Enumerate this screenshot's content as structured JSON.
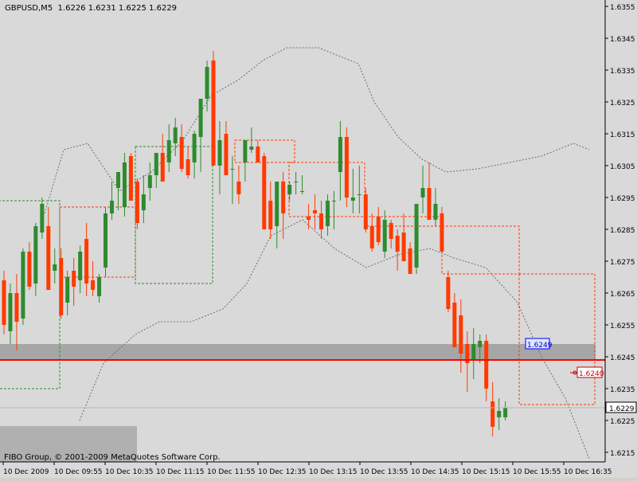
{
  "header": {
    "symbol": "GBPUSD,M5",
    "ohlc": "1.6226 1.6231 1.6225 1.6229"
  },
  "footer": {
    "copyright": "FIBO Group, © 2001-2009 MetaQuotes Software Corp."
  },
  "colors": {
    "background": "#d9d9d9",
    "bull": "#2e8b2e",
    "bear": "#ff3a00",
    "support_line": "#ff0000",
    "band": "#888888",
    "zone": "#a6a6a6"
  },
  "chart_data": {
    "type": "candlestick",
    "title": "GBPUSD,M5",
    "y_range": [
      1.6212,
      1.6357
    ],
    "y_ticks": [
      "1.6355",
      "1.6345",
      "1.6335",
      "1.6325",
      "1.6315",
      "1.6305",
      "1.6295",
      "1.6285",
      "1.6275",
      "1.6265",
      "1.6255",
      "1.6245",
      "1.6235",
      "1.6225",
      "1.6215"
    ],
    "x_ticks": [
      "10 Dec 2009",
      "10 Dec 09:55",
      "10 Dec 10:35",
      "10 Dec 11:15",
      "10 Dec 11:55",
      "10 Dec 12:35",
      "10 Dec 13:15",
      "10 Dec 13:55",
      "10 Dec 14:35",
      "10 Dec 15:15",
      "10 Dec 15:55",
      "10 Dec 16:35"
    ],
    "current_price": "1.6229",
    "price_labels": [
      {
        "text": "1.6249",
        "value": 1.6249,
        "style": "blue"
      },
      {
        "text": "1.6240",
        "value": 1.624,
        "style": "red"
      }
    ],
    "support_level": 1.6244,
    "zone": {
      "from": 1.6244,
      "to": 1.6249
    },
    "candles": [
      [
        1.6269,
        1.6272,
        1.6252,
        1.6255
      ],
      [
        1.6253,
        1.6268,
        1.6249,
        1.6265
      ],
      [
        1.6265,
        1.6271,
        1.6247,
        1.6256
      ],
      [
        1.6257,
        1.6279,
        1.6255,
        1.6278
      ],
      [
        1.6278,
        1.6281,
        1.6266,
        1.6267
      ],
      [
        1.6268,
        1.6287,
        1.6264,
        1.6286
      ],
      [
        1.6284,
        1.6295,
        1.6282,
        1.6293
      ],
      [
        1.6286,
        1.6292,
        1.6266,
        1.6266
      ],
      [
        1.6272,
        1.6279,
        1.6268,
        1.6274
      ],
      [
        1.6276,
        1.6279,
        1.6257,
        1.6258
      ],
      [
        1.6262,
        1.6272,
        1.6258,
        1.627
      ],
      [
        1.6272,
        1.6276,
        1.6261,
        1.6267
      ],
      [
        1.6269,
        1.628,
        1.6265,
        1.6278
      ],
      [
        1.6282,
        1.6287,
        1.6264,
        1.6268
      ],
      [
        1.6269,
        1.6275,
        1.6264,
        1.6266
      ],
      [
        1.6264,
        1.6271,
        1.6262,
        1.627
      ],
      [
        1.6273,
        1.6292,
        1.627,
        1.629
      ],
      [
        1.629,
        1.63,
        1.6288,
        1.6294
      ],
      [
        1.6298,
        1.6302,
        1.6291,
        1.6303
      ],
      [
        1.6292,
        1.6309,
        1.6289,
        1.6306
      ],
      [
        1.6308,
        1.6309,
        1.6294,
        1.6294
      ],
      [
        1.63,
        1.6301,
        1.6285,
        1.6287
      ],
      [
        1.6291,
        1.6302,
        1.6287,
        1.6296
      ],
      [
        1.6298,
        1.6306,
        1.6294,
        1.6302
      ],
      [
        1.6302,
        1.6308,
        1.6298,
        1.6309
      ],
      [
        1.6309,
        1.6315,
        1.6302,
        1.63
      ],
      [
        1.6306,
        1.6318,
        1.6303,
        1.6313
      ],
      [
        1.6312,
        1.632,
        1.6308,
        1.6317
      ],
      [
        1.6314,
        1.6318,
        1.6303,
        1.6304
      ],
      [
        1.6307,
        1.6311,
        1.6301,
        1.6302
      ],
      [
        1.6306,
        1.6316,
        1.6301,
        1.6315
      ],
      [
        1.6314,
        1.6326,
        1.6303,
        1.6326
      ],
      [
        1.6326,
        1.6338,
        1.6322,
        1.6336
      ],
      [
        1.6338,
        1.6341,
        1.6305,
        1.6305
      ],
      [
        1.6305,
        1.6319,
        1.6296,
        1.6313
      ],
      [
        1.6315,
        1.6319,
        1.6305,
        1.6302
      ],
      [
        1.6304,
        1.6308,
        1.6293,
        1.6304
      ],
      [
        1.63,
        1.6305,
        1.6293,
        1.6296
      ],
      [
        1.6306,
        1.6311,
        1.63,
        1.6313
      ],
      [
        1.631,
        1.6317,
        1.6309,
        1.6311
      ],
      [
        1.6311,
        1.6313,
        1.6306,
        1.6306
      ],
      [
        1.6308,
        1.6309,
        1.6286,
        1.6285
      ],
      [
        1.6294,
        1.63,
        1.6282,
        1.6285
      ],
      [
        1.6286,
        1.63,
        1.6279,
        1.63
      ],
      [
        1.63,
        1.6303,
        1.6282,
        1.629
      ],
      [
        1.6296,
        1.63,
        1.6294,
        1.6299
      ],
      [
        1.63,
        1.6303,
        1.6296,
        1.63
      ],
      [
        1.6297,
        1.6302,
        1.6296,
        1.6297
      ],
      [
        1.6289,
        1.6293,
        1.6285,
        1.6288
      ],
      [
        1.6291,
        1.6296,
        1.6285,
        1.629
      ],
      [
        1.629,
        1.6294,
        1.6282,
        1.6285
      ],
      [
        1.6286,
        1.6296,
        1.6283,
        1.6294
      ],
      [
        1.6294,
        1.6297,
        1.6285,
        1.6294
      ],
      [
        1.6303,
        1.6319,
        1.6294,
        1.6314
      ],
      [
        1.6314,
        1.6317,
        1.6292,
        1.6295
      ],
      [
        1.6294,
        1.6304,
        1.629,
        1.6295
      ],
      [
        1.6296,
        1.6305,
        1.629,
        1.6296
      ],
      [
        1.6296,
        1.6298,
        1.6284,
        1.6285
      ],
      [
        1.6286,
        1.629,
        1.6278,
        1.6279
      ],
      [
        1.6289,
        1.6292,
        1.628,
        1.6281
      ],
      [
        1.6278,
        1.6291,
        1.6276,
        1.6288
      ],
      [
        1.6287,
        1.6288,
        1.6279,
        1.6282
      ],
      [
        1.6283,
        1.6285,
        1.6272,
        1.6278
      ],
      [
        1.6284,
        1.629,
        1.6275,
        1.6275
      ],
      [
        1.6279,
        1.6281,
        1.6271,
        1.6271
      ],
      [
        1.6273,
        1.6291,
        1.6271,
        1.6293
      ],
      [
        1.6295,
        1.6305,
        1.629,
        1.6298
      ],
      [
        1.6298,
        1.6306,
        1.6289,
        1.6288
      ],
      [
        1.6288,
        1.6298,
        1.6286,
        1.6293
      ],
      [
        1.629,
        1.6292,
        1.6278,
        1.6278
      ],
      [
        1.627,
        1.6272,
        1.6259,
        1.626
      ],
      [
        1.6262,
        1.6265,
        1.625,
        1.6248
      ],
      [
        1.6258,
        1.6263,
        1.624,
        1.6246
      ],
      [
        1.6249,
        1.6253,
        1.6234,
        1.6243
      ],
      [
        1.6244,
        1.6254,
        1.6238,
        1.6249
      ],
      [
        1.6248,
        1.6252,
        1.6243,
        1.625
      ],
      [
        1.625,
        1.6252,
        1.6231,
        1.6235
      ],
      [
        1.6231,
        1.6237,
        1.622,
        1.6223
      ],
      [
        1.6226,
        1.6232,
        1.6222,
        1.6228
      ],
      [
        1.6226,
        1.6231,
        1.6225,
        1.6229
      ]
    ],
    "x_start": 5,
    "x_step": 7.97,
    "bands": {
      "upper": [
        [
          56,
          1.629
        ],
        [
          80,
          1.631
        ],
        [
          110,
          1.6312
        ],
        [
          150,
          1.6297
        ],
        [
          190,
          1.6303
        ],
        [
          230,
          1.6313
        ],
        [
          265,
          1.6327
        ],
        [
          300,
          1.6332
        ],
        [
          330,
          1.6338
        ],
        [
          360,
          1.6342
        ],
        [
          400,
          1.6342
        ],
        [
          450,
          1.6337
        ],
        [
          470,
          1.6325
        ],
        [
          500,
          1.6314
        ],
        [
          530,
          1.6307
        ],
        [
          560,
          1.6303
        ],
        [
          600,
          1.6304
        ],
        [
          640,
          1.6306
        ],
        [
          680,
          1.6308
        ],
        [
          720,
          1.6312
        ],
        [
          740,
          1.631
        ]
      ],
      "lower": [
        [
          100,
          1.6225
        ],
        [
          130,
          1.6243
        ],
        [
          170,
          1.6252
        ],
        [
          200,
          1.6256
        ],
        [
          240,
          1.6256
        ],
        [
          280,
          1.626
        ],
        [
          310,
          1.6268
        ],
        [
          340,
          1.6283
        ],
        [
          380,
          1.6288
        ],
        [
          420,
          1.6279
        ],
        [
          460,
          1.6273
        ],
        [
          500,
          1.6277
        ],
        [
          540,
          1.6279
        ],
        [
          570,
          1.6276
        ],
        [
          610,
          1.6273
        ],
        [
          650,
          1.6262
        ],
        [
          680,
          1.6245
        ],
        [
          710,
          1.6232
        ],
        [
          740,
          1.6213
        ]
      ]
    },
    "boxes": [
      {
        "x1": -2,
        "x2": 75,
        "top": 1.6294,
        "bottom": 1.6235,
        "color": "#2e8b2e"
      },
      {
        "x1": 75,
        "x2": 170,
        "top": 1.6292,
        "bottom": 1.627,
        "color": "#ff3a00"
      },
      {
        "x1": 170,
        "x2": 267,
        "top": 1.6311,
        "bottom": 1.6268,
        "color": "#2e8b2e"
      },
      {
        "x1": 295,
        "x2": 370,
        "top": 1.6313,
        "bottom": 1.6306,
        "color": "#ff3a00"
      },
      {
        "x1": 363,
        "x2": 458,
        "top": 1.6306,
        "bottom": 1.6289,
        "color": "#ff3a00"
      },
      {
        "x1": 458,
        "x2": 555,
        "top": 1.6289,
        "bottom": 1.6286,
        "color": "#ff3a00"
      },
      {
        "x1": 555,
        "x2": 652,
        "top": 1.6286,
        "bottom": 1.6271,
        "color": "#ff3a00"
      },
      {
        "x1": 652,
        "x2": 747,
        "top": 1.6271,
        "bottom": 1.623,
        "color": "#ff3a00"
      }
    ]
  }
}
